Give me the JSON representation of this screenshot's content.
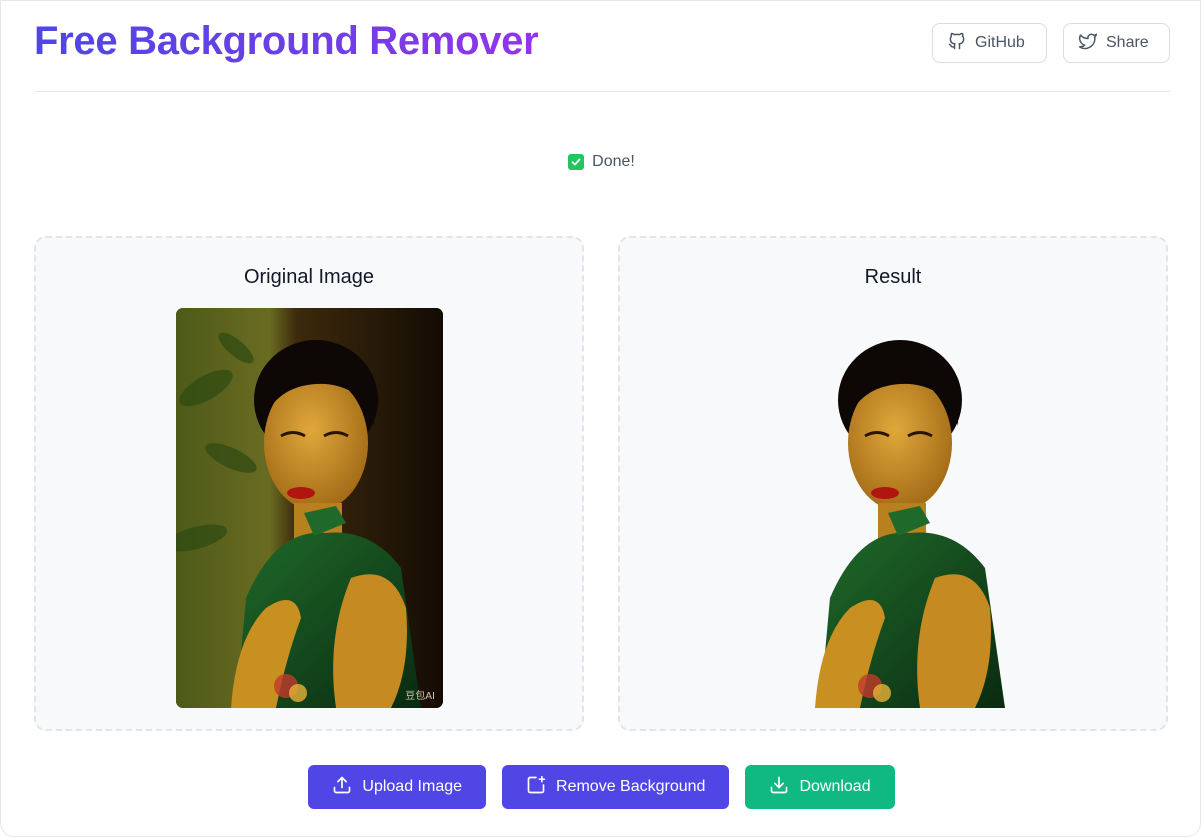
{
  "header": {
    "title": "Free Background Remover",
    "github_label": "GitHub",
    "share_label": "Share"
  },
  "status": {
    "text": "Done!",
    "icon": "check-square-icon"
  },
  "panels": {
    "original_title": "Original Image",
    "result_title": "Result",
    "watermark": "豆包AI"
  },
  "actions": {
    "upload_label": "Upload Image",
    "remove_label": "Remove Background",
    "download_label": "Download"
  },
  "colors": {
    "accent": "#4f46e5",
    "accent_gradient_end": "#9333ea",
    "success": "#10b981",
    "status_check": "#22c55e"
  }
}
